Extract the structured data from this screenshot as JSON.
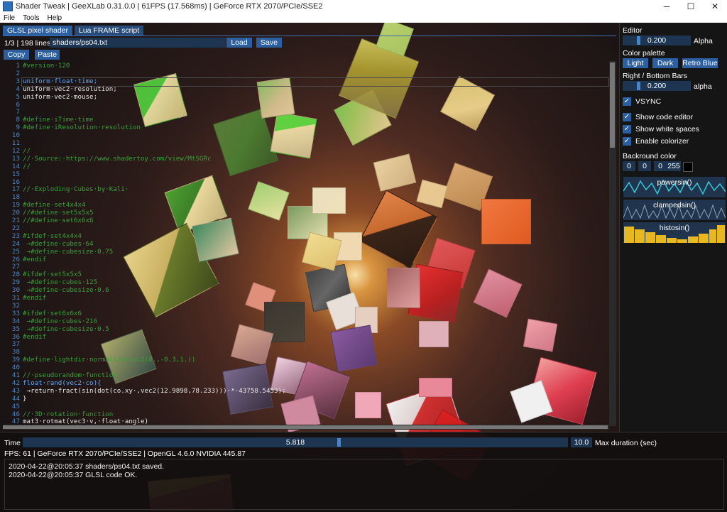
{
  "window": {
    "title": "Shader Tweak | GeeXLab 0.31.0.0 | 61FPS (17.568ms) | GeForce RTX 2070/PCIe/SSE2",
    "minimize": "─",
    "maximize": "☐",
    "close": "✕"
  },
  "menu": [
    "File",
    "Tools",
    "Help"
  ],
  "tabs": [
    "GLSL pixel shader",
    "Lua FRAME script"
  ],
  "editor": {
    "lines_info": "1/3 | 198 lines",
    "path": "shaders/ps04.txt",
    "load_label": "Load",
    "save_label": "Save",
    "copy_label": "Copy",
    "paste_label": "Paste"
  },
  "code_lines": [
    {
      "n": "1",
      "t": "#version·120",
      "c": "cmt"
    },
    {
      "n": "2",
      "t": "",
      "c": ""
    },
    {
      "n": "3",
      "t": "uniform·float·time;",
      "c": "kw"
    },
    {
      "n": "4",
      "t": "uniform·vec2·resolution;",
      "c": ""
    },
    {
      "n": "5",
      "t": "uniform·vec2·mouse;",
      "c": ""
    },
    {
      "n": "6",
      "t": "",
      "c": ""
    },
    {
      "n": "7",
      "t": "",
      "c": ""
    },
    {
      "n": "8",
      "t": "#define·iTime·time",
      "c": "cmt"
    },
    {
      "n": "9",
      "t": "#define·iResolution·resolution",
      "c": "cmt"
    },
    {
      "n": "10",
      "t": "",
      "c": ""
    },
    {
      "n": "11",
      "t": "",
      "c": ""
    },
    {
      "n": "12",
      "t": "//",
      "c": "cmt"
    },
    {
      "n": "13",
      "t": "//·Source:·https://www.shadertoy.com/view/MtSGRc",
      "c": "cmt"
    },
    {
      "n": "14",
      "t": "//",
      "c": "cmt"
    },
    {
      "n": "15",
      "t": "",
      "c": ""
    },
    {
      "n": "16",
      "t": "",
      "c": ""
    },
    {
      "n": "17",
      "t": "//·Exploding·Cubes·by·Kali·",
      "c": "cmt"
    },
    {
      "n": "18",
      "t": "",
      "c": ""
    },
    {
      "n": "19",
      "t": "#define·set4x4x4",
      "c": "cmt"
    },
    {
      "n": "20",
      "t": "//#define·set5x5x5",
      "c": "cmt"
    },
    {
      "n": "21",
      "t": "//#define·set6x6x6",
      "c": "cmt"
    },
    {
      "n": "22",
      "t": "",
      "c": ""
    },
    {
      "n": "23",
      "t": "#ifdef·set4x4x4",
      "c": "cmt"
    },
    {
      "n": "24",
      "t": " →#define·cubes·64",
      "c": "cmt"
    },
    {
      "n": "25",
      "t": " →#define·cubesize·0.75",
      "c": "cmt"
    },
    {
      "n": "26",
      "t": "#endif",
      "c": "cmt"
    },
    {
      "n": "27",
      "t": "",
      "c": ""
    },
    {
      "n": "28",
      "t": "#ifdef·set5x5x5",
      "c": "cmt"
    },
    {
      "n": "29",
      "t": " →#define·cubes·125",
      "c": "cmt"
    },
    {
      "n": "30",
      "t": " →#define·cubesize·0.6",
      "c": "cmt"
    },
    {
      "n": "31",
      "t": "#endif",
      "c": "cmt"
    },
    {
      "n": "32",
      "t": "",
      "c": ""
    },
    {
      "n": "33",
      "t": "#ifdef·set6x6x6",
      "c": "cmt"
    },
    {
      "n": "34",
      "t": " →#define·cubes·216",
      "c": "cmt"
    },
    {
      "n": "35",
      "t": " →#define·cubesize·0.5",
      "c": "cmt"
    },
    {
      "n": "36",
      "t": "#endif",
      "c": "cmt"
    },
    {
      "n": "37",
      "t": "",
      "c": ""
    },
    {
      "n": "38",
      "t": "",
      "c": ""
    },
    {
      "n": "39",
      "t": "#define·lightdir·normalize(vec3(0.,-0.3,1.))",
      "c": "cmt"
    },
    {
      "n": "40",
      "t": "",
      "c": ""
    },
    {
      "n": "41",
      "t": "//·pseudorandom·function",
      "c": "cmt"
    },
    {
      "n": "42",
      "t": "float·rand(vec2·co){",
      "c": "kw"
    },
    {
      "n": "43",
      "t": " →return·fract(sin(dot(co.xy·,vec2(12.9898,78.233)))·*·43758.5453);",
      "c": ""
    },
    {
      "n": "44",
      "t": "}",
      "c": ""
    },
    {
      "n": "45",
      "t": "",
      "c": ""
    },
    {
      "n": "46",
      "t": "//·3D·rotation·function",
      "c": "cmt"
    },
    {
      "n": "47",
      "t": "mat3·rotmat(vec3·v,·float·angle)",
      "c": ""
    }
  ],
  "right_panel": {
    "editor_label": "Editor",
    "editor_alpha_value": "0.200",
    "alpha_label": "Alpha",
    "palette_label": "Color palette",
    "palette_buttons": [
      "Light",
      "Dark",
      "Retro Blue"
    ],
    "bars_label": "Right / Bottom Bars",
    "bars_alpha_value": "0.200",
    "bars_alpha_label": "alpha",
    "vsync_label": "VSYNC",
    "show_code_editor_label": "Show code editor",
    "show_white_spaces_label": "Show white spaces",
    "enable_colorizer_label": "Enable colorizer",
    "bg_color_label": "Backround color",
    "bg_color": [
      "0",
      "0",
      "0",
      "255"
    ],
    "plot_labels": [
      "powersin()",
      "clampedsin()",
      "histosin()"
    ]
  },
  "bottom": {
    "time_label": "Time",
    "time_value": "5.818",
    "time_fraction": 0.58,
    "max_duration_value": "10.0",
    "max_duration_label": "Max duration (sec)",
    "status": "FPS: 61 | GeForce RTX 2070/PCIe/SSE2 | OpenGL 4.6.0 NVIDIA 445.87",
    "log": [
      "2020-04-22@20:05:37 shaders/ps04.txt saved.",
      "2020-04-22@20:05:37 GLSL code OK."
    ]
  },
  "colors": {
    "accent": "#2b5fa0",
    "panel": "#1e3552",
    "comment": "#38a138",
    "keyword": "#5aa8ff"
  }
}
